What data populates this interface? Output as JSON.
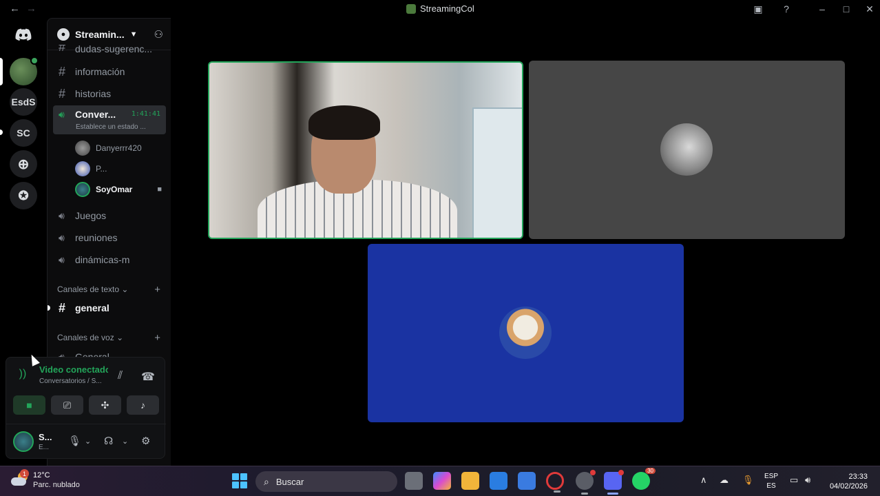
{
  "window": {
    "title": "StreamingCol"
  },
  "servers": [
    {
      "label": ""
    },
    {
      "label": "EsdS"
    },
    {
      "label": "SC"
    }
  ],
  "guild": {
    "name": "Streamin..."
  },
  "channels": {
    "partial_top": "dudas-sugerenc...",
    "text_top": [
      "información",
      "historias"
    ],
    "active_voice": {
      "name": "Conver...",
      "timer": "1:41:41",
      "status": "Establece un estado ..."
    },
    "voice_users": [
      {
        "name": "Danyerrr420"
      },
      {
        "name": "P..."
      },
      {
        "name": "SoyOmar"
      }
    ],
    "voice_more": [
      "Juegos",
      "reuniones",
      "dinámicas-m"
    ],
    "cat_text": "Canales de texto",
    "text_channels": [
      "general"
    ],
    "cat_voice": "Canales de voz",
    "voice_partial": "General"
  },
  "voice_panel": {
    "status": "Video conectado",
    "location": "Conversatorios / S...",
    "user_name": "S...",
    "user_status": "E..."
  },
  "taskbar": {
    "weather_temp": "12°C",
    "weather_cond": "Parc. nublado",
    "weather_badge": "1",
    "search": "Buscar",
    "whatsapp_count": "30",
    "lang_top": "ESP",
    "lang_bottom": "ES",
    "time": "23:33",
    "date": "04/02/2026"
  },
  "colors": {
    "accent_green": "#23a55a",
    "blue_tile": "#1a33a2",
    "gray_tile": "#464646"
  }
}
